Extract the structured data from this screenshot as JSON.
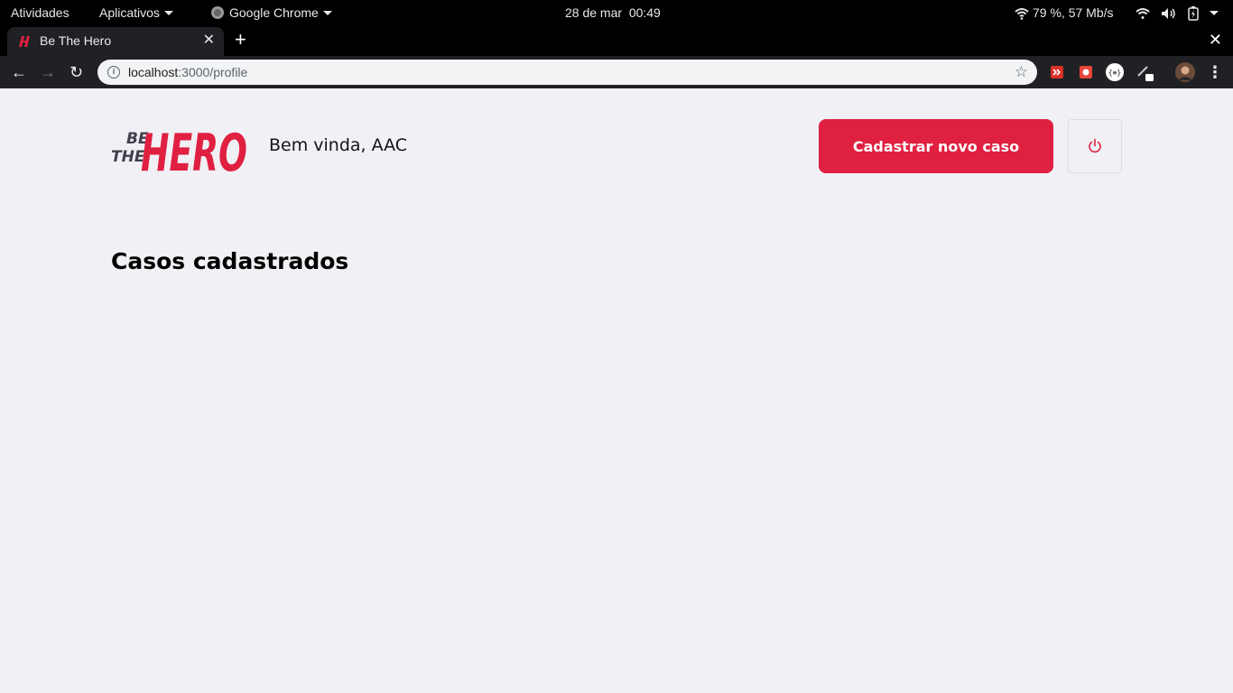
{
  "system_bar": {
    "activities": "Atividades",
    "applications": "Aplicativos",
    "app_name": "Google Chrome",
    "clock": "28 de mar  00:49",
    "network_status": "79 %, 57 Mb/s"
  },
  "browser": {
    "tab_title": "Be The Hero",
    "url_host": "localhost",
    "url_rest": ":3000/profile"
  },
  "page": {
    "logo": {
      "line1": "BE",
      "line2": "THE",
      "word": "HERO"
    },
    "welcome": "Bem vinda, AAC",
    "new_case_button": "Cadastrar novo caso",
    "section_title": "Casos cadastrados"
  },
  "colors": {
    "brand": "#e02041",
    "page_background": "#f0f0f5",
    "text": "#13131a"
  },
  "icons": {
    "logout": "power-icon",
    "bookmark": "star-icon"
  }
}
